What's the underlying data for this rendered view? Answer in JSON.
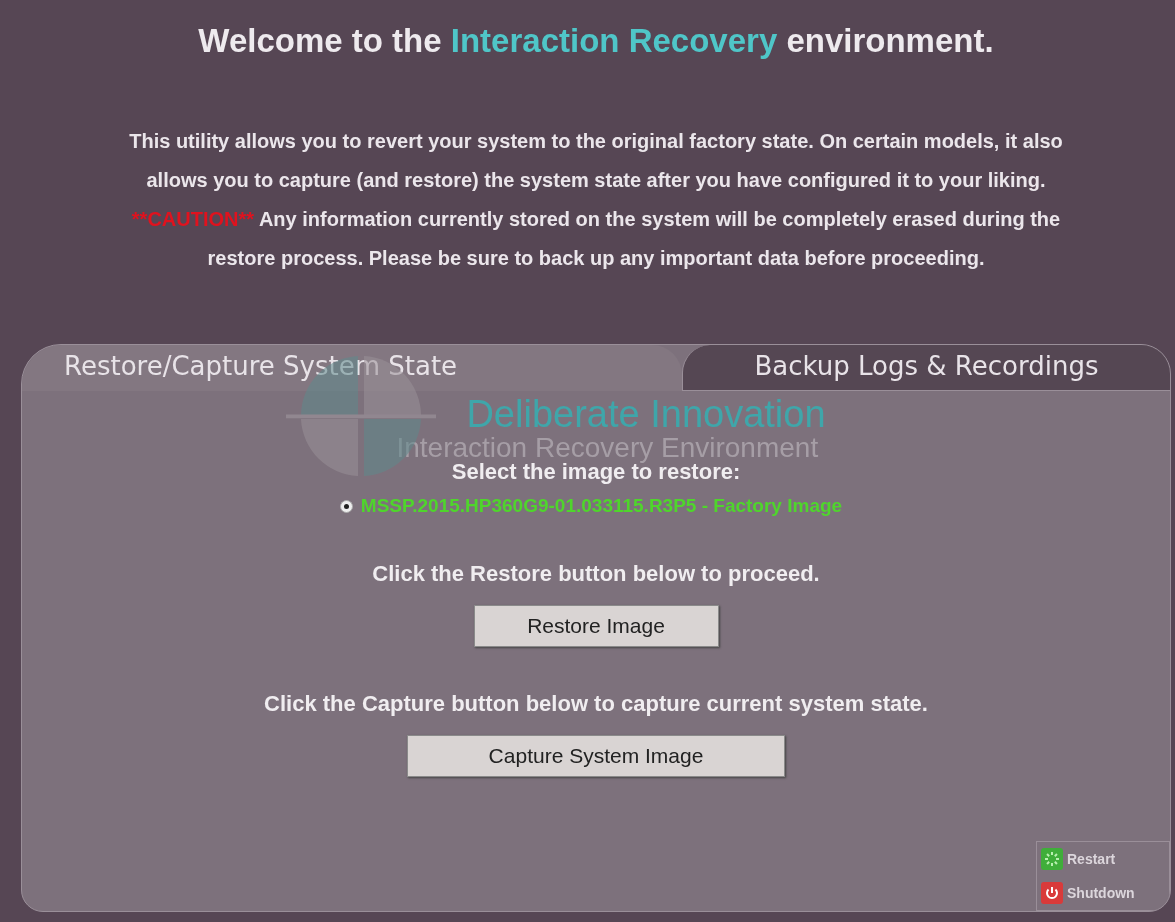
{
  "title": [
    {
      "text": "Welcome to the ",
      "kind": "plain"
    },
    {
      "text": "Interaction Recovery",
      "kind": "highlight"
    },
    {
      "text": " environment.",
      "kind": "plain"
    }
  ],
  "intro": [
    {
      "text": "This utility allows you to revert your system to the original factory state. On certain models, it also allows you to capture (and restore) the system state after you have configured it to your liking. ",
      "kind": "plain"
    },
    {
      "text": "**CAUTION**",
      "kind": "caution"
    },
    {
      "text": " Any information currently stored on the system will be completely erased during the restore process. Please be sure to back up any important data before proceeding.",
      "kind": "plain"
    }
  ],
  "tabs": [
    {
      "label": "Restore/Capture System State",
      "selected": true
    },
    {
      "label": "Backup Logs & Recordings",
      "selected": false
    }
  ],
  "logo": {
    "name": "Deliberate Innovation",
    "subtitle": "Interaction Recovery Environment"
  },
  "restore": {
    "prompt": "Select the image to restore:",
    "images": [
      {
        "label": "MSSP.2015.HP360G9-01.033115.R3P5 - Factory Image",
        "selected": true
      }
    ],
    "hint": "Click the Restore button below to proceed.",
    "button": "Restore Image"
  },
  "capture": {
    "hint": "Click the Capture button below to capture current system state.",
    "button": "Capture System Image"
  },
  "power": [
    {
      "label": "Restart",
      "kind": "restart"
    },
    {
      "label": "Shutdown",
      "kind": "shutdown"
    }
  ]
}
